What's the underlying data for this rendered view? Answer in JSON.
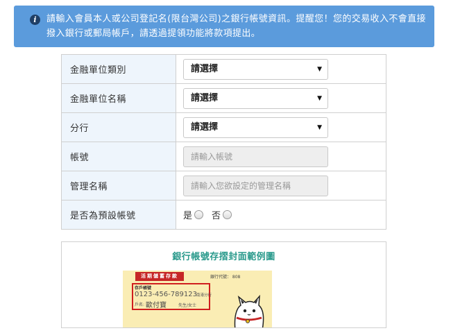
{
  "alert": {
    "icon": "info-icon",
    "text": "請輸入會員本人或公司登記名(限台灣公司)之銀行帳號資訊。提醒您！您的交易收入不會直接撥入銀行或郵局帳戶，請透過提領功能將款項提出。"
  },
  "form": {
    "bank_type": {
      "label": "金融單位類別",
      "value": "請選擇"
    },
    "bank_name": {
      "label": "金融單位名稱",
      "value": "請選擇"
    },
    "branch": {
      "label": "分行",
      "value": "請選擇"
    },
    "account": {
      "label": "帳號",
      "placeholder": "請輸入帳號"
    },
    "nickname": {
      "label": "管理名稱",
      "placeholder": "請輸入您欲設定的管理名稱"
    },
    "default": {
      "label": "是否為預設帳號",
      "yes": "是",
      "no": "否"
    }
  },
  "example": {
    "title": "銀行帳號存摺封面範例圖",
    "passbook": {
      "header": "活期儲蓄存款",
      "bank_code": "銀行代號： 808",
      "account_label": "存戶帳號",
      "account_number": "0123-456-789123",
      "branch": "南港分行",
      "name_label": "戶名:",
      "name": "歐付寶",
      "name_suffix": "先生/女士"
    }
  },
  "colors": {
    "alert_bg": "#5b9bdc",
    "label_bg": "#eef5fc",
    "title": "#2a9a8c",
    "passbook_bg": "#faedb4",
    "highlight": "#d01e1e"
  }
}
